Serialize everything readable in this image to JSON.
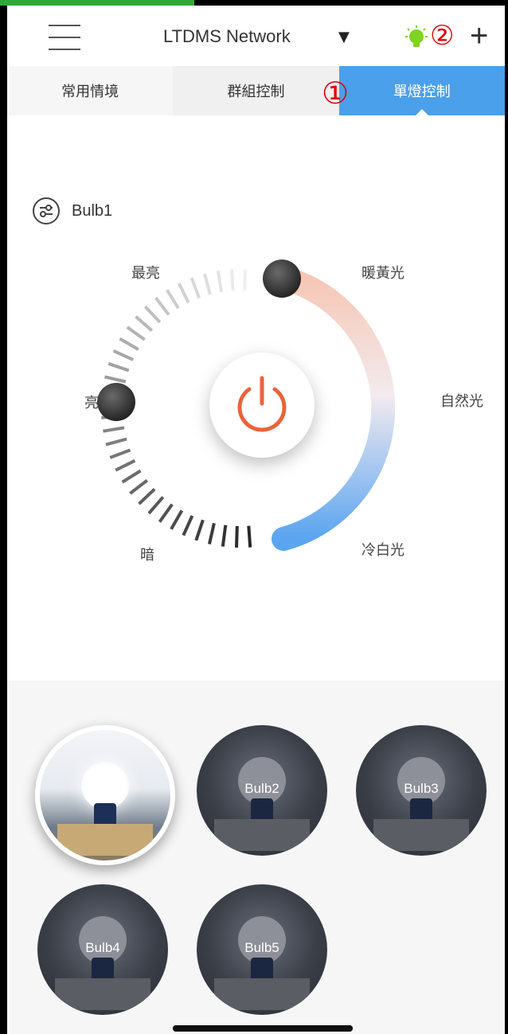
{
  "header": {
    "network_title": "LTDMS Network",
    "network_caret": "▼",
    "menu_icon": "hamburger-menu-icon",
    "status_icon": "lightbulb-icon",
    "add_symbol": "+",
    "annotation_2": "②"
  },
  "tabs": [
    {
      "label": "常用情境",
      "active": false
    },
    {
      "label": "群組控制",
      "active": false
    },
    {
      "label": "單燈控制",
      "active": true
    }
  ],
  "annotation_1": "①",
  "device": {
    "icon": "settings-sliders-icon",
    "name": "Bulb1"
  },
  "brightness": {
    "label_max": "最亮",
    "label_mid": "亮",
    "label_min": "暗"
  },
  "color_temp": {
    "label_warm": "暖黃光",
    "label_natural": "自然光",
    "label_cool": "冷白光"
  },
  "power": {
    "icon": "power-icon",
    "accent_color": "#e8643c"
  },
  "bulbs": [
    {
      "label": "",
      "selected": true
    },
    {
      "label": "Bulb2",
      "selected": false
    },
    {
      "label": "Bulb3",
      "selected": false
    },
    {
      "label": "Bulb4",
      "selected": false
    },
    {
      "label": "Bulb5",
      "selected": false
    }
  ],
  "colors": {
    "active_tab": "#4aa0ea",
    "warm": "#f6c6b4",
    "cool": "#5aa4f0",
    "annotation": "#e00000"
  }
}
